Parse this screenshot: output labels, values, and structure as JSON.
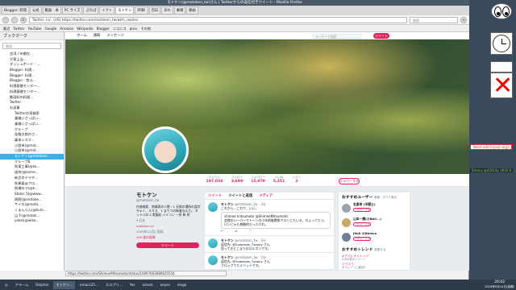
{
  "window": {
    "title": "モトケン(@motoken_tw)さん | Twitterからの返信付きツイート - Mozilla Firefox"
  },
  "tabs": [
    {
      "label": "Blogger: 料理"
    },
    {
      "label": "公式"
    },
    {
      "label": "動画 - 本"
    },
    {
      "label": "PC サイズ"
    },
    {
      "label": "ぷちぱ"
    },
    {
      "label": "イクト"
    },
    {
      "label": "モトケン"
    },
    {
      "label": "評価!"
    },
    {
      "label": "百日"
    },
    {
      "label": "あれ"
    },
    {
      "label": "乗確"
    },
    {
      "label": "動画"
    }
  ],
  "url": {
    "address": "Twitter, Inc. (US)  https://twitter.com/motoken_tw/with_replies",
    "search_placeholder": "検索"
  },
  "bookmarks_bar": [
    "最近",
    "Twitter",
    "YouTube",
    "Google",
    "Amazon",
    "Wikipedia",
    "Blogger",
    "ニコニコ",
    "pixiv",
    "その他"
  ],
  "sidebar": {
    "title": "ブックマーク",
    "search_placeholder": "検索",
    "items": [
      "台湾 / 布爾在...",
      "災害上当...",
      "ダッシュボード - ...",
      "Blogger: 料理...",
      "Blogger: 料理...",
      "Blogger - 悠斗...",
      "料理基礎センター...",
      "料理基礎センター...",
      "動画料の料理...",
      "Twitter",
      "お返事",
      "Twitterの再検索",
      "乗継いさっぱい...",
      "乗継いさっぱい...",
      "グループ",
      "金融太郎のさ...",
      "乗本いスマ...",
      "小説市(@mot...",
      "小説市(@mot...",
      "モトケン(@motoken...",
      "グループB",
      "知東工事(@ko...",
      "迷奈(@kome...",
      "新言のヤマチ...",
      "吹奏楽@ブロ...",
      "魚瀬ロマ(@k...",
      "Stokic 5(@www...",
      "周囲(@motoke...",
      "サイエ(@moto...",
      "くまんらん(@kum...",
      "山下(@motok...",
      "yokki(@wiko..."
    ],
    "selected_index": 19
  },
  "twitter_nav": {
    "items": [
      "ホーム",
      "通知",
      "メッセージ"
    ],
    "search_placeholder": "キーワード検索",
    "tweet_button": "ツイート"
  },
  "profile": {
    "name": "モトケン",
    "handle": "@motoken_tw",
    "bio": "作曲検索、地域再の人数・1 天郎の場所の誤字 ちゃく、スミス、1 までつの新者なんで。 ネットいの 2 電脳化 ハイコン 一所 新 所",
    "location": "日本",
    "website": "motoken.cn",
    "joined": "2009年12月に登録",
    "media": "165 枚の画像",
    "tweet_to_button": "ツイート",
    "stats": [
      {
        "label": "ツイート",
        "value": "197,034"
      },
      {
        "label": "フォロー",
        "value": "3,699"
      },
      {
        "label": "フォロワー",
        "value": "15,979"
      },
      {
        "label": "いいね",
        "value": "5,351"
      },
      {
        "label": "リスト",
        "value": "2"
      }
    ],
    "follow_button": "フォローする"
  },
  "timeline": {
    "tabs": [
      "ツイート",
      "ツイートと返信",
      "メディア"
    ],
    "tweets": [
      {
        "name": "モトケン",
        "handle": "@motoken_tw · 3分",
        "text": "これから…これで、いい。",
        "quote_name": "shimoe mitsumoto @ShimoeMitsumoto",
        "quote_text": "会館のいーパーでトーンの小年前後関係でロンじたいる、ちょってたら、ロンじゃた感動的だったけれ。"
      },
      {
        "name": "モトケン",
        "handle": "@motoken_tw · 3分",
        "text": "返信先: @Suwende_Tzowry さん",
        "quote_name": "",
        "quote_text": "思ってきとこまりのロルボンです。"
      },
      {
        "name": "モトケン",
        "handle": "@motoken_tw · 5分",
        "text": "返信先: @Suwende_Tzowry さん",
        "quote_name": "",
        "quote_text": "クロックてたメリットです。"
      }
    ]
  },
  "suggestions": {
    "title": "おすすめユーザー",
    "subtitle": "更新 · すべて表示",
    "users": [
      {
        "name": "名素奈 (半蔵士)",
        "follow": "フォローする"
      },
      {
        "name": "山本一樹(@Boll...)",
        "follow": "フォローする"
      },
      {
        "name": "Jitch @Jitchca",
        "follow": "フォローする"
      }
    ],
    "trends_title": "おすすめトレンド",
    "trends_sub": "変更する",
    "trends": [
      {
        "tag": "#アルにチャレンジ",
        "sub": "5,283件のツイート"
      },
      {
        "tag": "ジョジョ",
        "sub": "タイムリーに追加中"
      }
    ]
  },
  "statusbar": {
    "text": "https://twitter.com/ShimoeMitsumoto/status/10097602880625554"
  },
  "taskbar": {
    "items": [
      "アラーム",
      "Dolphin",
      "モトケン...",
      "emacs25...",
      "エスプリ...",
      "Yes",
      "xclock",
      "xeyes",
      "xlogo"
    ],
    "active_index": 2,
    "time": "20:02",
    "date": "2018年9月14日(金曜)"
  },
  "desktop": {
    "note1": "Tweet-add-mysql-ung.t",
    "note2": "Emacy-apt2014y 2016 K"
  },
  "colors": {
    "accent": "#e0245e",
    "selection": "#3daee9",
    "taskbar": "#2d3a48"
  }
}
